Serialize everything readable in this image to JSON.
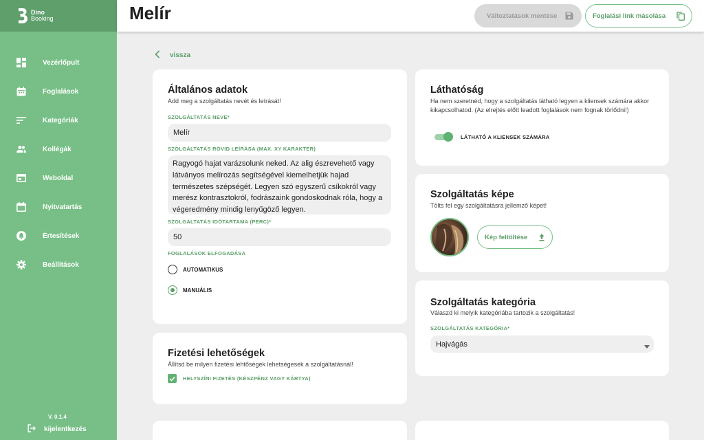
{
  "brand": {
    "line1": "Dino",
    "line2": "Booking"
  },
  "nav": [
    {
      "label": "Vezérlőpult",
      "icon": "dashboard-icon"
    },
    {
      "label": "Foglalások",
      "icon": "calendar-icon"
    },
    {
      "label": "Kategóriák",
      "icon": "sort-list-icon"
    },
    {
      "label": "Kollégák",
      "icon": "people-icon"
    },
    {
      "label": "Weboldal",
      "icon": "web-icon"
    },
    {
      "label": "Nyitvatartás",
      "icon": "calendar-blank-icon"
    },
    {
      "label": "Értesítések",
      "icon": "bell-icon"
    },
    {
      "label": "Beállítások",
      "icon": "gear-icon"
    }
  ],
  "version": "V. 0.1.4",
  "logout_label": "kijelentkezés",
  "header": {
    "title": "Melír",
    "save_label": "Változtatások mentése",
    "copy_label": "Foglalási link másolása"
  },
  "back_label": "vissza",
  "general": {
    "title": "Általános adatok",
    "subtitle": "Add meg a szolgáltatás nevét és leírását!",
    "name_label": "SZOLGÁLTATÁS NEVE*",
    "name_value": "Melír",
    "desc_label": "SZOLGÁLTATÁS RÖVID LEÍRÁSA (MAX. XY KARAKTER)",
    "desc_value": "Ragyogó hajat varázsolunk neked. Az alig észrevehető vagy látványos melírozás segítségével kiemelhetjük hajad természetes szépségét. Legyen szó egyszerű csíkokról vagy merész kontrasztokról, fodrászaink gondoskodnak róla, hogy a végeredmény mindig lenyűgöző legyen.",
    "duration_label": "SZOLGÁLTATÁS IDŐTARTAMA (PERC)*",
    "duration_value": "50",
    "acceptance_label": "FOGLALÁSOK ELFOGADÁSA",
    "option_auto": "AUTOMATIKUS",
    "option_manual": "MANUÁLIS",
    "selected_option": "MANUÁLIS"
  },
  "payment": {
    "title": "Fizetési lehetőségek",
    "subtitle": "Állítsd be milyen fizetési lehtőségek lehetségesek a szolgáltatásnál!",
    "onsite_label": "HELYSZÍNI FIZETÉS (KÉSZPÉNZ VAGY KÁRTYA)",
    "onsite_checked": true
  },
  "visibility": {
    "title": "Láthatóság",
    "subtitle": "Ha nem szeretnéd, hogy a szolgáltatás látható legyen a kliensek számára akkor kikapcsolhatod. (Az elrejtés előtt leadott foglalások nem fognak törlődni!)",
    "toggle_label": "LÁTHATÓ A KLIENSEK SZÁMÁRA",
    "toggle_on": true
  },
  "image": {
    "title": "Szolgáltatás képe",
    "subtitle": "Tölts fel egy szolgáltatásra jellemző képet!",
    "upload_label": "Kép feltöltése"
  },
  "category": {
    "title": "Szolgáltatás kategória",
    "subtitle": "Válaszd ki melyik kategóriába tartozik a szolgáltatás!",
    "field_label": "SZOLGÁLTATÁS KATEGÓRIA*",
    "selected": "Hajvágás"
  },
  "colors": {
    "accent": "#77bf86",
    "accent_dark": "#5a9e68",
    "sidebar_head": "#5f9f6c"
  }
}
